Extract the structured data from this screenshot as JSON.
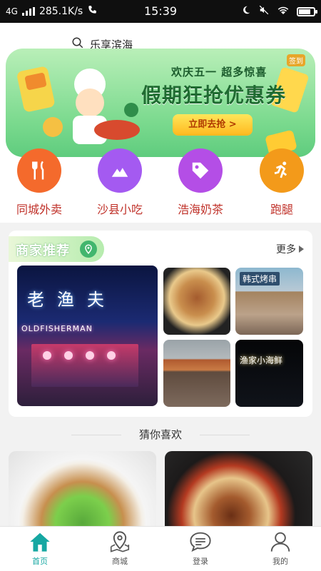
{
  "status_bar": {
    "network": "4G",
    "speed": "285.1K/s",
    "time": "15:39"
  },
  "search": {
    "location": "乐享滨海"
  },
  "banner": {
    "subtitle": "欢庆五一 超多惊喜",
    "title": "假期狂抢优惠券",
    "cta": "立即去抢 >",
    "tag": "签到",
    "bg_color": "#79d98d"
  },
  "quick_nav": [
    {
      "label": "同城外卖",
      "icon": "fork-knife-icon",
      "color": "#f46a2c"
    },
    {
      "label": "沙县小吃",
      "icon": "mountain-icon",
      "color": "#a45af1"
    },
    {
      "label": "浩海奶茶",
      "icon": "tag-icon",
      "color": "#b44ee6"
    },
    {
      "label": "跑腿",
      "icon": "runner-icon",
      "color": "#f39a1a"
    }
  ],
  "recommend": {
    "title": "商家推荐",
    "more": "更多",
    "main_sign": "老渔夫",
    "main_sign_en": "OLDFISHERMAN",
    "bbq_sign": "韩式烤串",
    "night_sign": "渔家小海鲜"
  },
  "guess": {
    "title": "猜你喜欢"
  },
  "tabbar": [
    {
      "label": "首页",
      "icon": "home-icon",
      "active": true
    },
    {
      "label": "商城",
      "icon": "map-pin-icon",
      "active": false
    },
    {
      "label": "登录",
      "icon": "chat-bubble-icon",
      "active": false
    },
    {
      "label": "我的",
      "icon": "user-icon",
      "active": false
    }
  ],
  "colors": {
    "accent": "#16a7a2",
    "nav_label": "#c0322a"
  }
}
